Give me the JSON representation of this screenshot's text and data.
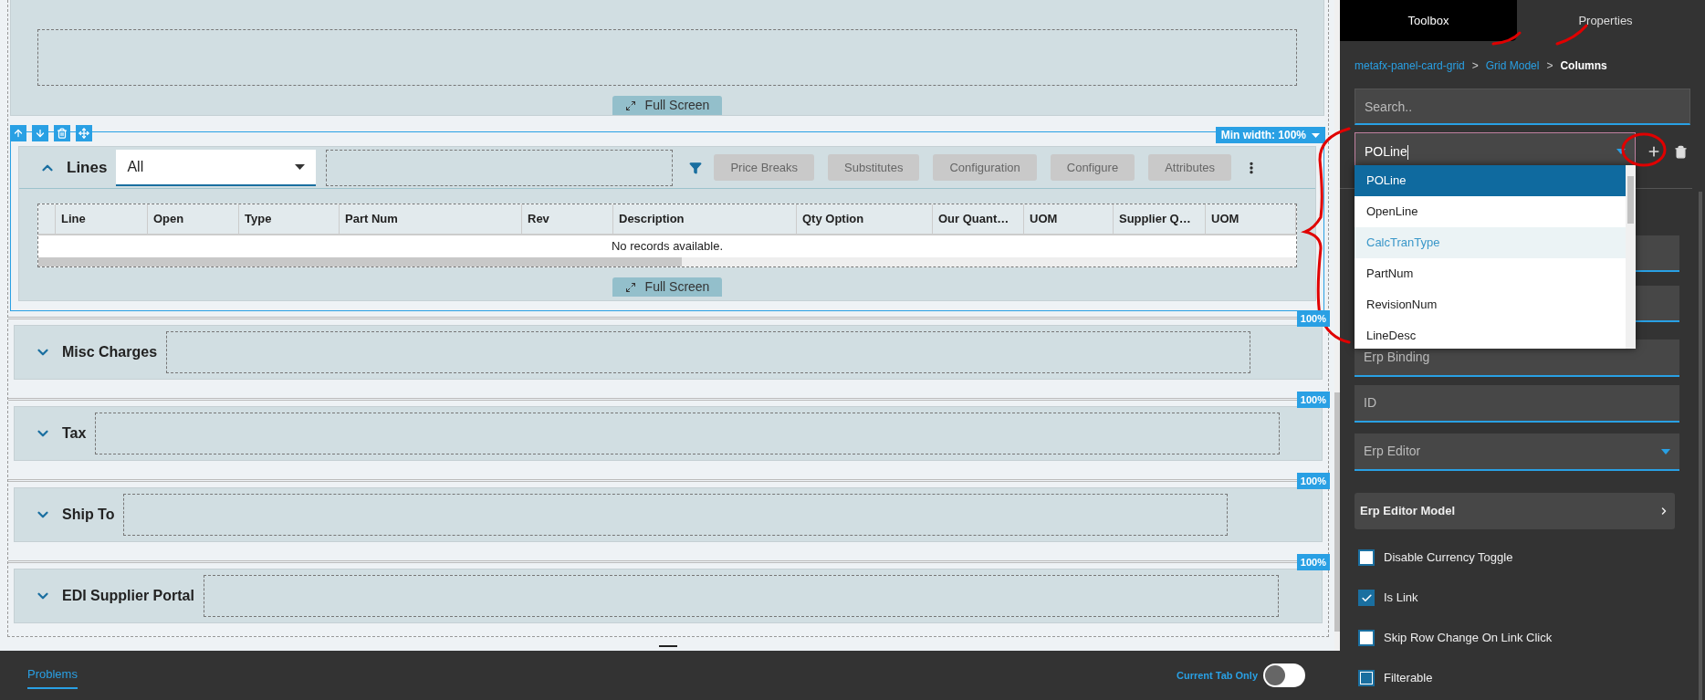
{
  "designer": {
    "top_card": {
      "full_screen": "Full Screen"
    },
    "lines_card": {
      "toolbar_actions": [
        {
          "kind": "up"
        },
        {
          "kind": "down"
        },
        {
          "kind": "delete"
        },
        {
          "kind": "move"
        }
      ],
      "min_width": "Min width: 100%",
      "title": "Lines",
      "expanded": true,
      "filter_select": {
        "value": "All"
      },
      "buttons": [
        "Price Breaks",
        "Substitutes",
        "Configuration",
        "Configure",
        "Attributes"
      ],
      "grid": {
        "columns": [
          "Line",
          "Open",
          "Type",
          "Part Num",
          "Rev",
          "Description",
          "Qty Option",
          "Our Quant…",
          "UOM",
          "Supplier Q…",
          "UOM"
        ],
        "empty_message": "No records available."
      },
      "full_screen": "Full Screen"
    },
    "panels": [
      {
        "title": "Misc Charges",
        "expanded": false,
        "width_badge": "100%"
      },
      {
        "title": "Tax",
        "expanded": false,
        "width_badge": "100%"
      },
      {
        "title": "Ship To",
        "expanded": false,
        "width_badge": "100%"
      },
      {
        "title": "EDI Supplier Portal",
        "expanded": false,
        "width_badge": "100%"
      }
    ]
  },
  "bottom_bar": {
    "tabs": [
      {
        "label": "Problems",
        "selected": true
      }
    ],
    "toggle": {
      "label": "Current Tab Only",
      "on": false
    }
  },
  "side_panel": {
    "tabs": [
      {
        "label": "Toolbox",
        "selected": true
      },
      {
        "label": "Properties",
        "selected": false
      }
    ],
    "breadcrumb": [
      {
        "kind": "link",
        "label": "metafx-panel-card-grid"
      },
      {
        "kind": "separator",
        "label": ">"
      },
      {
        "kind": "link",
        "label": "Grid Model"
      },
      {
        "kind": "separator",
        "label": ">"
      },
      {
        "kind": "current",
        "label": "Columns"
      }
    ],
    "search": {
      "placeholder": "Search.."
    },
    "column_select": {
      "value": "POLine",
      "options": [
        {
          "label": "POLine",
          "selected": true,
          "highlighted": false
        },
        {
          "label": "OpenLine",
          "selected": false,
          "highlighted": false
        },
        {
          "label": "CalcTranType",
          "selected": false,
          "highlighted": true
        },
        {
          "label": "PartNum",
          "selected": false,
          "highlighted": false
        },
        {
          "label": "RevisionNum",
          "selected": false,
          "highlighted": false
        },
        {
          "label": "LineDesc",
          "selected": false,
          "highlighted": false
        }
      ]
    },
    "fields": [
      {
        "kind": "input",
        "placeholder": "Erp Binding"
      },
      {
        "kind": "input",
        "placeholder": "ID"
      },
      {
        "kind": "select",
        "placeholder": "Erp Editor"
      },
      {
        "kind": "expander",
        "label": "Erp Editor Model"
      }
    ],
    "checkboxes": [
      {
        "label": "Disable Currency Toggle",
        "checked": false,
        "indeterminate": false
      },
      {
        "label": "Is Link",
        "checked": true,
        "indeterminate": false
      },
      {
        "label": "Skip Row Change On Link Click",
        "checked": false,
        "indeterminate": false
      },
      {
        "label": "Filterable",
        "checked": false,
        "indeterminate": true
      }
    ]
  }
}
